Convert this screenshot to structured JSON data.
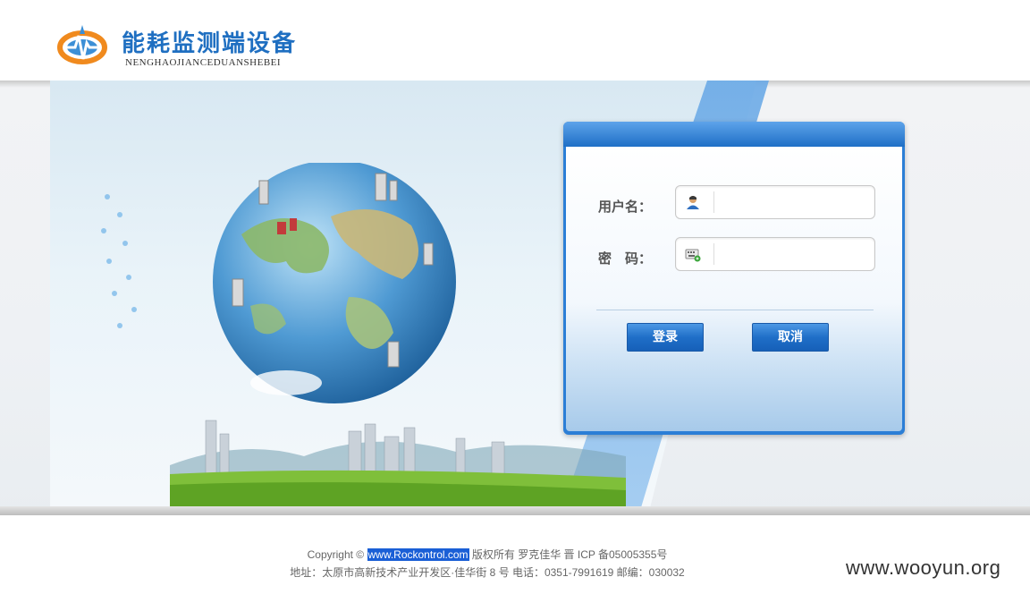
{
  "header": {
    "title": "能耗监测端设备",
    "subtitle": "NENGHAOJIANCEDUANSHEBEI",
    "logo_icon": "logo-emblem-icon"
  },
  "login": {
    "username_label": "用户名：",
    "password_label": "密　码：",
    "username_value": "",
    "password_value": "",
    "username_icon": "user-icon",
    "password_icon": "keyboard-icon",
    "login_button": "登录",
    "cancel_button": "取消"
  },
  "footer": {
    "copyright_prefix": "Copyright ©",
    "site_link": "www.Rockontrol.com",
    "copyright_suffix": "版权所有 罗克佳华 晋 ICP 备05005355号",
    "address": "地址：太原市高新技术产业开发区·佳华街 8 号 电话：0351-7991619 邮编：030032"
  },
  "watermark": "www.wooyun.org",
  "colors": {
    "brand_blue": "#1f6fc1",
    "panel_blue": "#2b7ed6",
    "button_blue": "#1f6fc8"
  }
}
